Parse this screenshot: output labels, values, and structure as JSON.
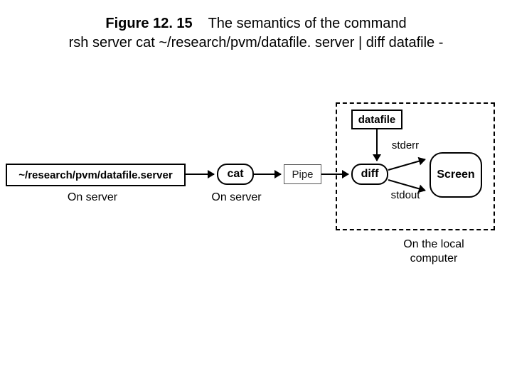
{
  "caption": {
    "figure_label": "Figure 12. 15",
    "desc_line1": "The semantics of the command",
    "desc_line2": "rsh server cat ~/research/pvm/datafile. server | diff datafile -"
  },
  "nodes": {
    "filepath": "~/research/pvm/datafile.server",
    "cat": "cat",
    "pipe": "Pipe",
    "datafile": "datafile",
    "diff": "diff",
    "screen": "Screen"
  },
  "labels": {
    "on_server": "On server",
    "stderr": "stderr",
    "stdout": "stdout",
    "local": "On the local computer"
  }
}
